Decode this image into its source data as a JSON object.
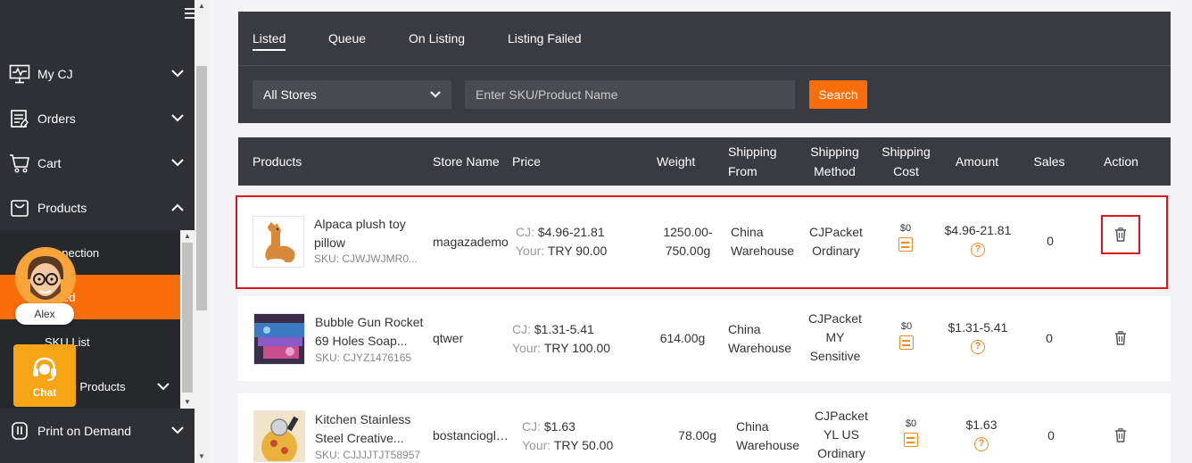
{
  "sidebar": {
    "menu": [
      {
        "label": "My CJ",
        "icon": "monitor-icon"
      },
      {
        "label": "Orders",
        "icon": "orders-icon"
      },
      {
        "label": "Cart",
        "icon": "cart-icon"
      },
      {
        "label": "Products",
        "icon": "bag-icon"
      },
      {
        "label": "Print on Demand",
        "icon": "pod-icon"
      }
    ],
    "submenu": [
      {
        "label": "Connection"
      },
      {
        "label": "Listed"
      },
      {
        "label": "SKU List"
      },
      {
        "label": "Service Products"
      }
    ],
    "visible_sub": [
      "nnection",
      "ed",
      "SKU List",
      "ce Products"
    ]
  },
  "avatar": {
    "name": "Alex"
  },
  "chat": {
    "label": "Chat"
  },
  "tabs": [
    {
      "label": "Listed"
    },
    {
      "label": "Queue"
    },
    {
      "label": "On Listing"
    },
    {
      "label": "Listing Failed"
    }
  ],
  "filters": {
    "store_value": "All Stores",
    "search_placeholder": "Enter SKU/Product Name",
    "search_label": "Search"
  },
  "table": {
    "headers": {
      "products": "Products",
      "store": "Store Name",
      "price": "Price",
      "weight": "Weight",
      "ship_from_1": "Shipping",
      "ship_from_2": "From",
      "ship_method_1": "Shipping",
      "ship_method_2": "Method",
      "ship_cost_1": "Shipping",
      "ship_cost_2": "Cost",
      "amount": "Amount",
      "sales": "Sales",
      "action": "Action"
    },
    "rows": [
      {
        "name_1": "Alpaca plush toy",
        "name_2": "pillow",
        "sku": "SKU: CJWJWJMR0...",
        "store": "magazademo",
        "cj_label": "CJ:",
        "cj_price": "$4.96-21.81",
        "your_label": "Your:",
        "your_price": "TRY 90.00",
        "weight_1": "1250.00-",
        "weight_2": "750.00g",
        "from_1": "China",
        "from_2": "Warehouse",
        "method_1": "CJPacket",
        "method_2": "Ordinary",
        "method_3": "",
        "cost": "$0",
        "amount": "$4.96-21.81",
        "sales": "0"
      },
      {
        "name_1": "Bubble Gun Rocket",
        "name_2": "69 Holes Soap...",
        "sku": "SKU: CJYZ1476165",
        "store": "qtwer",
        "cj_label": "CJ:",
        "cj_price": "$1.31-5.41",
        "your_label": "Your:",
        "your_price": "TRY 100.00",
        "weight_1": "614.00g",
        "weight_2": "",
        "from_1": "China",
        "from_2": "Warehouse",
        "method_1": "CJPacket",
        "method_2": "MY",
        "method_3": "Sensitive",
        "cost": "$0",
        "amount": "$1.31-5.41",
        "sales": "0"
      },
      {
        "name_1": "Kitchen Stainless",
        "name_2": "Steel Creative...",
        "sku": "SKU: CJJJJTJT58957",
        "store": "bostancioglu...",
        "cj_label": "CJ:",
        "cj_price": "$1.63",
        "your_label": "Your:",
        "your_price": "TRY 50.00",
        "weight_1": "78.00g",
        "weight_2": "",
        "from_1": "China",
        "from_2": "Warehouse",
        "method_1": "CJPacket",
        "method_2": "YL US",
        "method_3": "Ordinary",
        "cost": "$0",
        "amount": "$1.63",
        "sales": "0"
      }
    ]
  },
  "colors": {
    "accent": "#f96d0b",
    "highlight": "#e0141c",
    "dark": "#3a3b40"
  }
}
